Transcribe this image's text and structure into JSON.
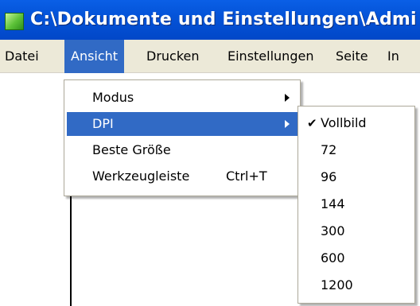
{
  "window": {
    "title": "C:\\Dokumente und Einstellungen\\Admi",
    "colors": {
      "titlebar": "#0453d8",
      "highlight": "#316ac5",
      "menubar": "#ece9d8"
    }
  },
  "menubar": {
    "items": [
      "Datei",
      "Ansicht",
      "Drucken",
      "Einstellungen",
      "Seite",
      "In"
    ]
  },
  "ansicht_menu": {
    "items": [
      {
        "label": "Modus",
        "has_submenu": true
      },
      {
        "label": "DPI",
        "has_submenu": true,
        "highlighted": true
      },
      {
        "label": "Beste Größe"
      },
      {
        "label": "Werkzeugleiste",
        "shortcut": "Ctrl+T"
      }
    ]
  },
  "dpi_submenu": {
    "selected": "Vollbild",
    "check_glyph": "✔",
    "items": [
      "Vollbild",
      "72",
      "96",
      "144",
      "300",
      "600",
      "1200"
    ]
  }
}
